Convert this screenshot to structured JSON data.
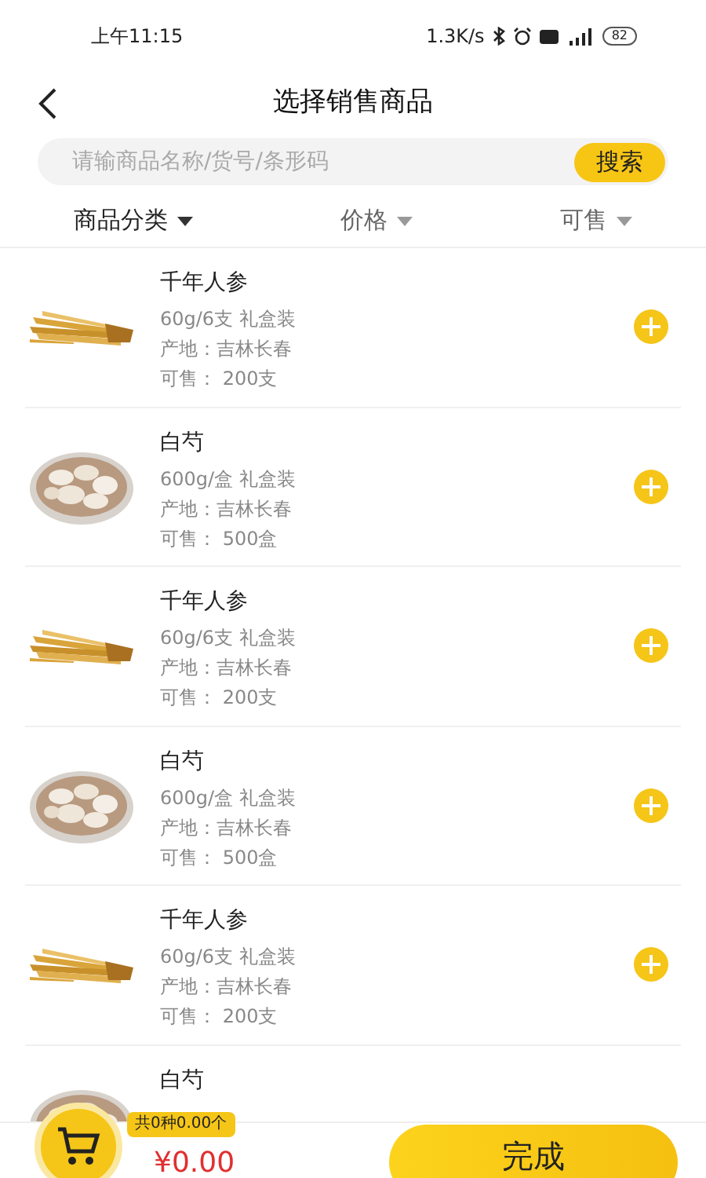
{
  "status_bar": {
    "time": "上午11:15",
    "speed": "1.3K/s",
    "battery": "82"
  },
  "header": {
    "title": "选择销售商品"
  },
  "search": {
    "placeholder": "请输商品名称/货号/条形码",
    "button": "搜索"
  },
  "filters": [
    {
      "label": "商品分类",
      "selected": true
    },
    {
      "label": "价格",
      "selected": false
    },
    {
      "label": "可售",
      "selected": false
    }
  ],
  "products": [
    {
      "kind": "ginseng",
      "name": "千年人参",
      "spec": "60g/6支 礼盒装",
      "origin": "产地：吉林长春",
      "stock": "可售： 200支"
    },
    {
      "kind": "slices",
      "name": "白芍",
      "spec": "600g/盒 礼盒装",
      "origin": "产地：吉林长春",
      "stock": "可售： 500盒"
    },
    {
      "kind": "ginseng",
      "name": "千年人参",
      "spec": "60g/6支 礼盒装",
      "origin": "产地：吉林长春",
      "stock": "可售： 200支"
    },
    {
      "kind": "slices",
      "name": "白芍",
      "spec": "600g/盒 礼盒装",
      "origin": "产地：吉林长春",
      "stock": "可售： 500盒"
    },
    {
      "kind": "ginseng",
      "name": "千年人参",
      "spec": "60g/6支 礼盒装",
      "origin": "产地：吉林长春",
      "stock": "可售： 200支"
    },
    {
      "kind": "slices",
      "name": "白芍"
    }
  ],
  "footer": {
    "count": "共0种0.00个",
    "price": "¥0.00",
    "done": "完成"
  }
}
